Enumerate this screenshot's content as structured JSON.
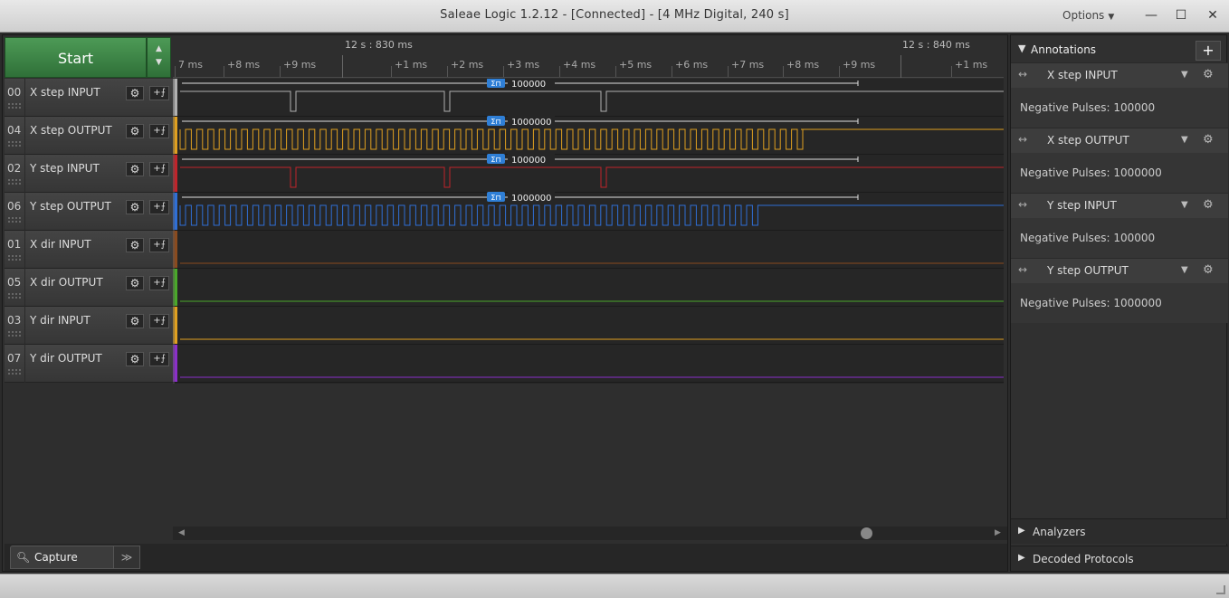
{
  "window": {
    "title": "Saleae Logic 1.2.12 - [Connected] - [4 MHz Digital, 240 s]",
    "options_label": "Options",
    "min_glyph": "—",
    "max_glyph": "☐",
    "close_glyph": "✕"
  },
  "toolbar": {
    "start_label": "Start",
    "up_glyph": "▲",
    "down_glyph": "▼"
  },
  "ruler": {
    "big_labels": [
      "12 s : 830 ms",
      "12 s : 840 ms"
    ],
    "ticks": [
      "7 ms",
      "+8 ms",
      "+9 ms",
      "+1 ms",
      "+2 ms",
      "+3 ms",
      "+4 ms",
      "+5 ms",
      "+6 ms",
      "+7 ms",
      "+8 ms",
      "+9 ms",
      "+1 ms"
    ]
  },
  "channels": [
    {
      "num": "00",
      "name": "X step INPUT",
      "color": "#b0b0b0",
      "measure": "100000"
    },
    {
      "num": "04",
      "name": "X step OUTPUT",
      "color": "#e0a020",
      "measure": "1000000"
    },
    {
      "num": "02",
      "name": "Y step INPUT",
      "color": "#c0242b",
      "measure": "100000"
    },
    {
      "num": "06",
      "name": "Y step OUTPUT",
      "color": "#2f6fd6",
      "measure": "1000000"
    },
    {
      "num": "01",
      "name": "X dir INPUT",
      "color": "#8a4b1f",
      "measure": ""
    },
    {
      "num": "05",
      "name": "X dir OUTPUT",
      "color": "#4aa82a",
      "measure": ""
    },
    {
      "num": "03",
      "name": "Y dir INPUT",
      "color": "#e0a020",
      "measure": ""
    },
    {
      "num": "07",
      "name": "Y dir OUTPUT",
      "color": "#8b2fc9",
      "measure": ""
    }
  ],
  "channel_icons": {
    "gear": "⚙",
    "trigger": "+⨍"
  },
  "bottom": {
    "capture_label": "Capture",
    "more_glyph": "≫"
  },
  "annotations": {
    "header": "Annotations",
    "add_glyph": "+",
    "items": [
      {
        "name": "X step INPUT",
        "value": "Negative Pulses: 100000"
      },
      {
        "name": "X step OUTPUT",
        "value": "Negative Pulses: 1000000"
      },
      {
        "name": "Y step INPUT",
        "value": "Negative Pulses: 100000"
      },
      {
        "name": "Y step OUTPUT",
        "value": "Negative Pulses: 1000000"
      }
    ]
  },
  "sections": {
    "analyzers": "Analyzers",
    "decoded": "Decoded Protocols"
  }
}
